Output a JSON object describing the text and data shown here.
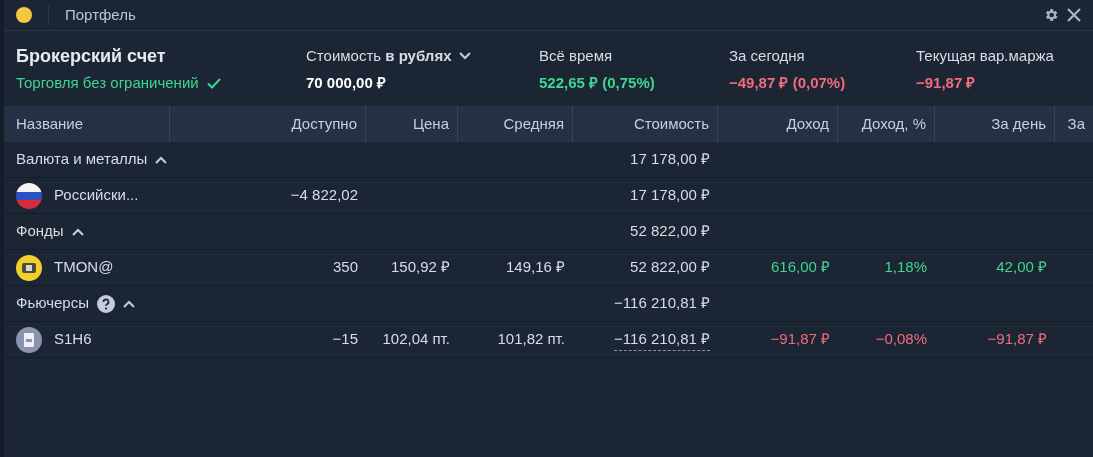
{
  "window": {
    "title": "Портфель"
  },
  "account": {
    "title": "Брокерский счет",
    "status": "Торговля без ограничений",
    "status_ok": true
  },
  "stats": [
    {
      "label": "Стоимость **в рублях**",
      "value": "70 000,00 ₽",
      "color": "#ffffff",
      "dropdown": true
    },
    {
      "label": "Всё время",
      "value": "522,65 ₽ (0,75%)",
      "color": "#3fd58f",
      "dropdown": false
    },
    {
      "label": "За сегодня",
      "value": "−49,87 ₽ (0,07%)",
      "color": "#f26b7d",
      "dropdown": false
    },
    {
      "label": "Текущая вар.маржа",
      "value": "−91,87 ₽",
      "color": "#f26b7d",
      "dropdown": false
    }
  ],
  "table": {
    "columns": [
      "Название",
      "Доступно",
      "Цена",
      "Средняя",
      "Стоимость",
      "Доход",
      "Доход, %",
      "За день",
      "За"
    ],
    "rows": [
      {
        "kind": "group",
        "name": "Валюта и металлы",
        "help": false,
        "expanded": true,
        "value": "17 178,00 ₽"
      },
      {
        "kind": "item",
        "name": "Российски...",
        "cells": [
          "−4 822,02",
          null,
          null,
          "17 178,00 ₽",
          null,
          null,
          null,
          null
        ]
      },
      {
        "kind": "group",
        "name": "Фонды",
        "help": false,
        "expanded": true,
        "value": "52 822,00 ₽"
      },
      {
        "kind": "item",
        "name": "TMON@",
        "loss": false,
        "cells": [
          "350",
          "150,92 ₽",
          "149,16 ₽",
          "52 822,00 ₽",
          "616,00 ₽",
          "1,18%",
          "42,00 ₽",
          null
        ]
      },
      {
        "kind": "group",
        "name": "Фьючерсы",
        "help": true,
        "expanded": true,
        "value": "−116 210,81 ₽"
      },
      {
        "kind": "item",
        "name": "S1H6",
        "loss": true,
        "cells": [
          "−15",
          "102,04 пт.",
          "101,82 пт.",
          "−116 210,81 ₽",
          "−91,87 ₽",
          "−0,08%",
          "−91,87 ₽",
          null
        ]
      }
    ]
  }
}
